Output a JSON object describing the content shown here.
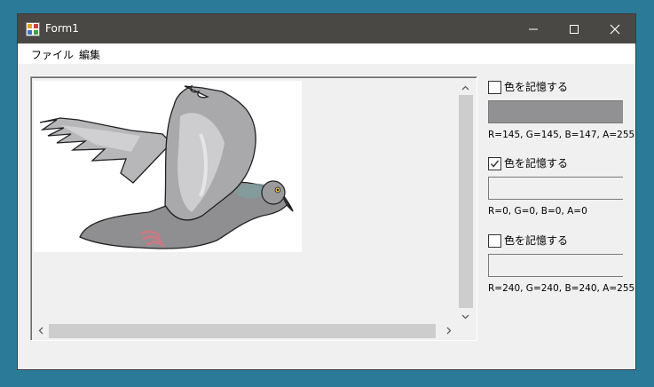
{
  "window": {
    "title": "Form1",
    "icon": "winforms-app-icon"
  },
  "menu": {
    "items": [
      "ファイル",
      "編集"
    ]
  },
  "viewer": {
    "image": "pigeon-illustration"
  },
  "colors": [
    {
      "label": "色を記憶する",
      "checked": false,
      "swatch": "#919193",
      "text": "R=145, G=145, B=147, A=255"
    },
    {
      "label": "色を記憶する",
      "checked": true,
      "swatch": "#f0f0f0",
      "text": "R=0, G=0, B=0, A=0"
    },
    {
      "label": "色を記憶する",
      "checked": false,
      "swatch": "#f0f0f0",
      "text": "R=240, G=240, B=240, A=255"
    }
  ]
}
